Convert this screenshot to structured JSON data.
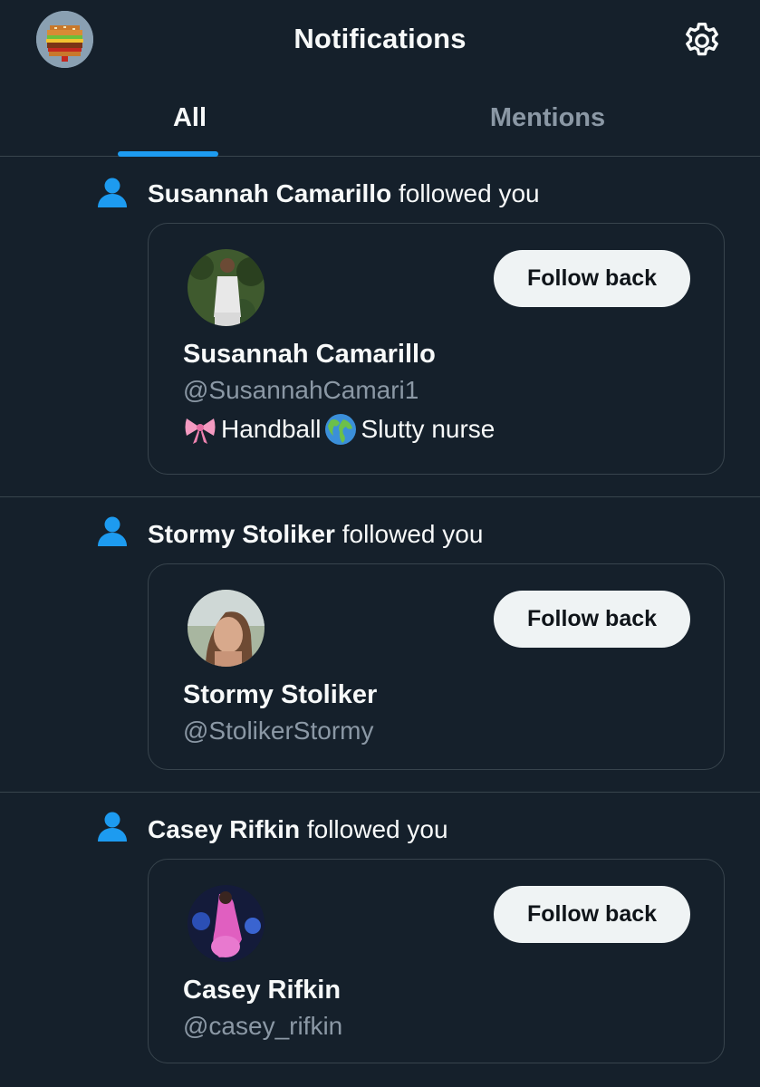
{
  "header": {
    "title": "Notifications",
    "avatar_icon": "burger-avatar",
    "settings_icon": "gear-icon"
  },
  "tabs": [
    {
      "label": "All",
      "active": true
    },
    {
      "label": "Mentions",
      "active": false
    }
  ],
  "colors": {
    "background": "#15202b",
    "accent": "#1d9bf0",
    "divider": "#38444d",
    "muted_text": "#8b98a5",
    "button_bg": "#eff3f4"
  },
  "notifications": [
    {
      "icon": "person-icon",
      "actor": "Susannah Camarillo",
      "action": "followed you",
      "card": {
        "name": "Susannah Camarillo",
        "handle": "@SusannahCamari1",
        "bio_parts": [
          "Handball",
          "Slutty nurse"
        ],
        "bio_icons": [
          "ribbon-bow-emoji",
          "globe-emoji"
        ],
        "button_label": "Follow back"
      }
    },
    {
      "icon": "person-icon",
      "actor": "Stormy Stoliker",
      "action": "followed you",
      "card": {
        "name": "Stormy Stoliker",
        "handle": "@StolikerStormy",
        "button_label": "Follow back"
      }
    },
    {
      "icon": "person-icon",
      "actor": "Casey Rifkin",
      "action": "followed you",
      "card": {
        "name": "Casey Rifkin",
        "handle": "@casey_rifkin",
        "button_label": "Follow back"
      }
    }
  ]
}
